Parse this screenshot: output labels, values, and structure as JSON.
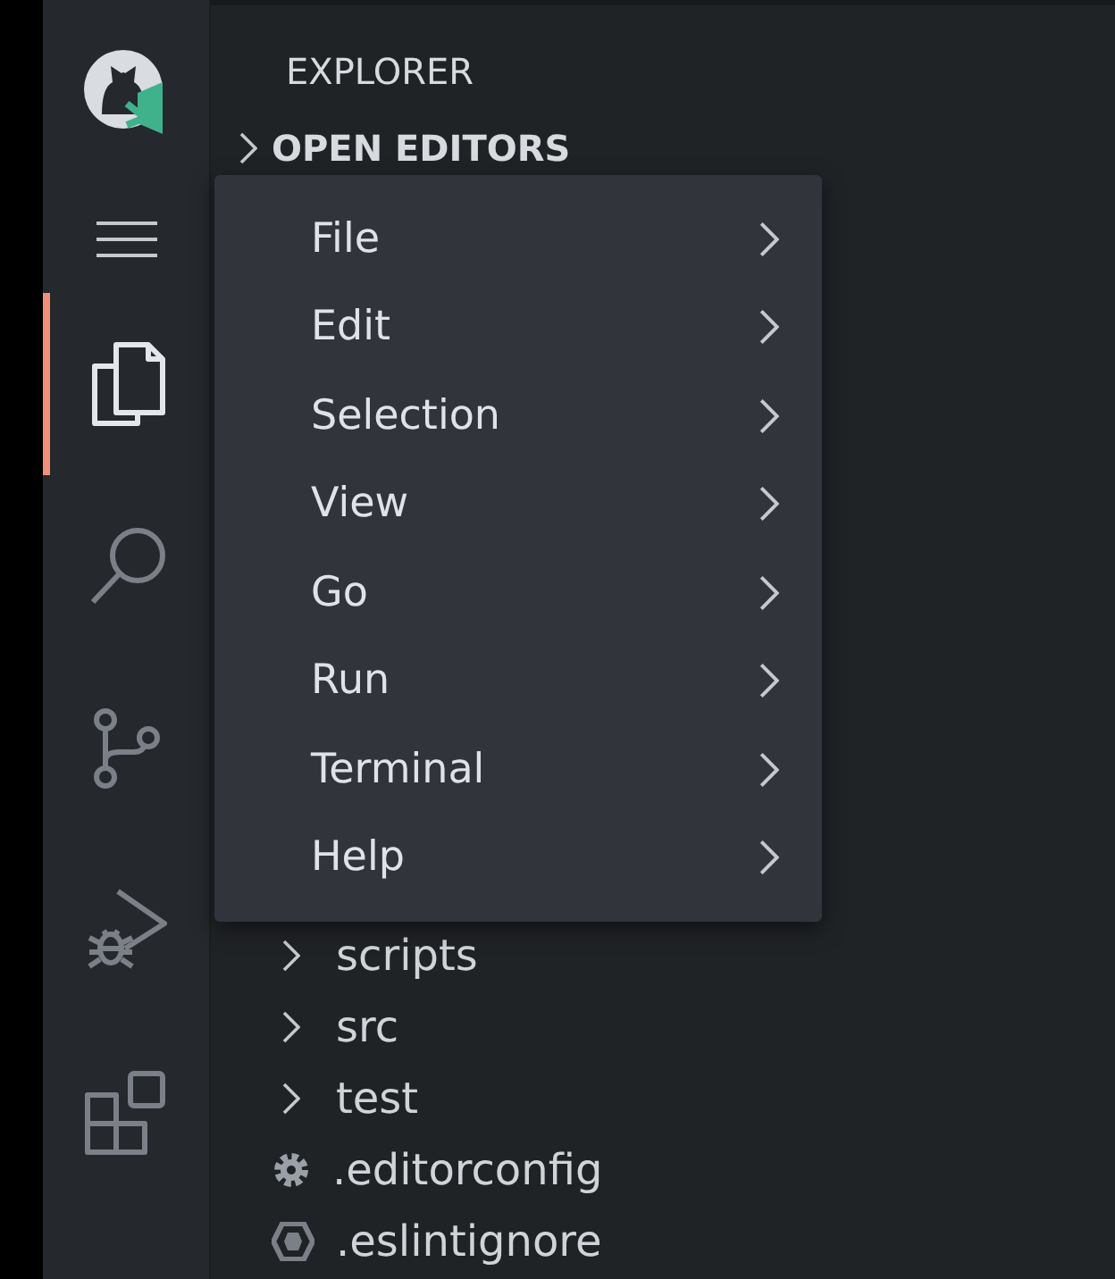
{
  "activity_bar": {
    "items": [
      {
        "selected": true
      },
      {
        "selected": false
      },
      {
        "selected": false
      },
      {
        "selected": false
      },
      {
        "selected": false
      }
    ]
  },
  "sidebar": {
    "title": "EXPLORER",
    "section": {
      "label": "OPEN EDITORS",
      "expanded": false
    },
    "tree": [
      {
        "label": "scripts",
        "kind": "folder",
        "expanded": false
      },
      {
        "label": "src",
        "kind": "folder",
        "expanded": false
      },
      {
        "label": "test",
        "kind": "folder",
        "expanded": false
      },
      {
        "label": ".editorconfig",
        "kind": "config"
      },
      {
        "label": ".eslintignore",
        "kind": "eslint"
      }
    ]
  },
  "menu": {
    "items": [
      {
        "label": "File",
        "submenu": true
      },
      {
        "label": "Edit",
        "submenu": true
      },
      {
        "label": "Selection",
        "submenu": true
      },
      {
        "label": "View",
        "submenu": true
      },
      {
        "label": "Go",
        "submenu": true
      },
      {
        "label": "Run",
        "submenu": true
      },
      {
        "label": "Terminal",
        "submenu": true
      },
      {
        "label": "Help",
        "submenu": true
      }
    ]
  }
}
